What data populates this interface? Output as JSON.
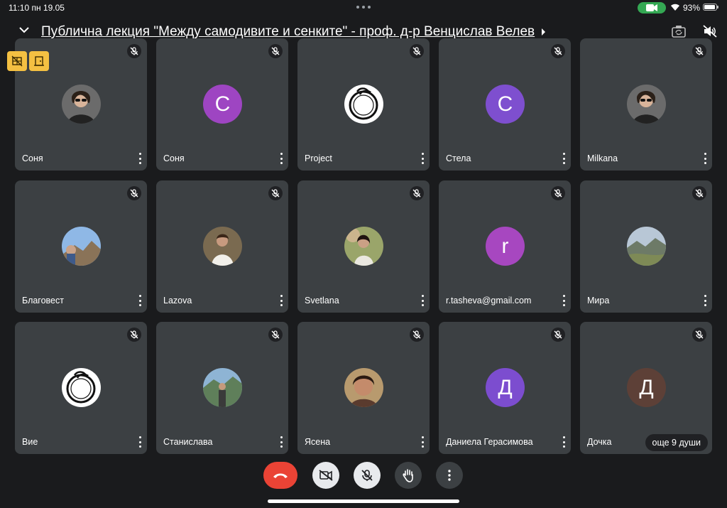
{
  "status_bar": {
    "time": "11:10  пн 19.05",
    "battery_percent": "93%",
    "battery_level": 0.93
  },
  "header": {
    "title": "Публична лекция \"Между самодивите и сенките\" - проф. д-р Венцислав Велев"
  },
  "colors": {
    "background": "#1a1b1d",
    "tile": "#3c4043",
    "end_call": "#ea4335",
    "control_light": "#e8eaed",
    "control_dark": "#3c4043",
    "camera_pill": "#34a853",
    "yellow_button": "#f4c042"
  },
  "participants": [
    {
      "name": "Соня",
      "avatar": {
        "kind": "photo",
        "icon": "woman-sunglasses-photo"
      }
    },
    {
      "name": "Соня",
      "avatar": {
        "kind": "letter",
        "letter": "C",
        "color": "#9e45c2"
      }
    },
    {
      "name": "Project",
      "avatar": {
        "kind": "logo",
        "icon": "snake-circle-logo"
      }
    },
    {
      "name": "Стела",
      "avatar": {
        "kind": "letter",
        "letter": "C",
        "color": "#7e4fcf"
      }
    },
    {
      "name": "Milkana",
      "avatar": {
        "kind": "photo",
        "icon": "woman-sunglasses-photo"
      }
    },
    {
      "name": "Благовест",
      "avatar": {
        "kind": "photo",
        "icon": "rock-landscape-photo"
      }
    },
    {
      "name": "Lazova",
      "avatar": {
        "kind": "photo",
        "icon": "woman-white-shirt-photo"
      }
    },
    {
      "name": "Svetlana",
      "avatar": {
        "kind": "photo",
        "icon": "woman-garden-photo"
      }
    },
    {
      "name": "r.tasheva@gmail.com",
      "avatar": {
        "kind": "letter",
        "letter": "r",
        "color": "#a747c0"
      }
    },
    {
      "name": "Мира",
      "avatar": {
        "kind": "photo",
        "icon": "mountain-landscape-photo"
      }
    },
    {
      "name": "Вие",
      "avatar": {
        "kind": "logo",
        "icon": "snake-circle-logo"
      }
    },
    {
      "name": "Станислава",
      "avatar": {
        "kind": "photo",
        "icon": "woman-mountains-photo"
      }
    },
    {
      "name": "Ясена",
      "avatar": {
        "kind": "photo",
        "icon": "woman-portrait-photo"
      }
    },
    {
      "name": "Даниела Герасимова",
      "avatar": {
        "kind": "letter",
        "letter": "Д",
        "color": "#7c4dcf"
      }
    },
    {
      "name": "Дочка",
      "avatar": {
        "kind": "letter",
        "letter": "Д",
        "color": "#5d4037"
      }
    }
  ],
  "others_badge": "още 9 души",
  "controls": [
    "end-call",
    "camera-off",
    "mic-off",
    "raise-hand",
    "more-options"
  ]
}
